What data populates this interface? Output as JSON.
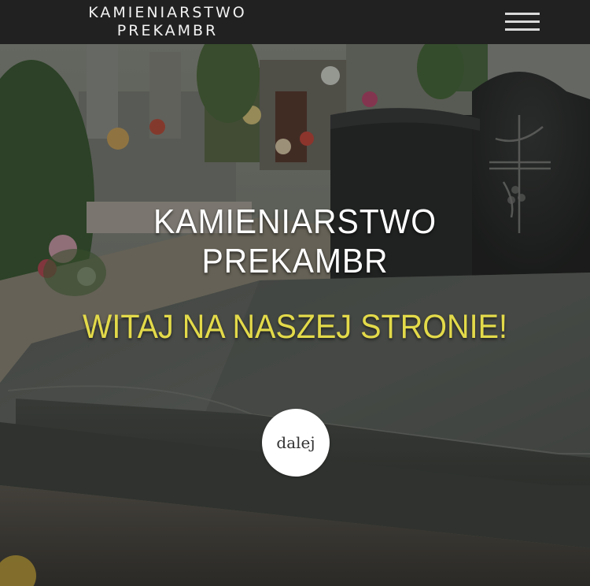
{
  "header": {
    "logo_line1": "KAMIENIARSTWO",
    "logo_line2": "PREKAMBR",
    "menu_icon": "hamburger-menu-icon"
  },
  "hero": {
    "title_line1": "KAMIENIARSTWO",
    "title_line2": "PREKAMBR",
    "subtitle": "WITAJ NA NASZEJ STRONIE!",
    "next_label": "dalej",
    "subtitle_color": "#e3da4a"
  },
  "colors": {
    "topbar": "#212121",
    "hero_text": "#ffffff",
    "accent_yellow": "#e3da4a"
  }
}
